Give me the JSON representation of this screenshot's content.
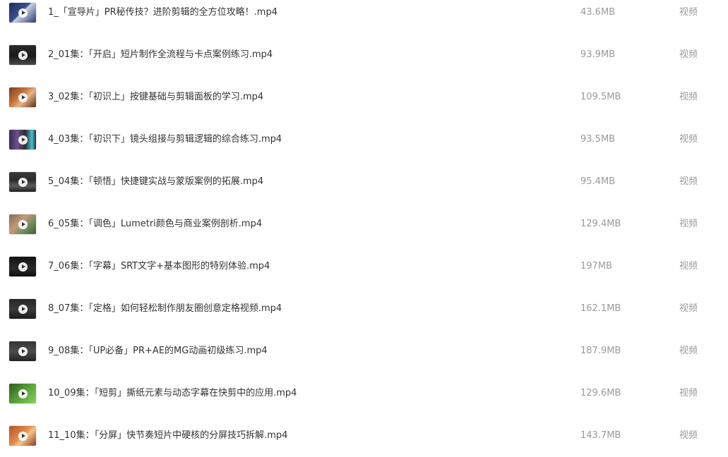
{
  "files": [
    {
      "name": "1_「宣导片」PR秘传技？进阶剪辑的全方位攻略！.mp4",
      "size": "43.6MB",
      "type": "视频",
      "thumb_style": "t-navy"
    },
    {
      "name": "2_01集：「开启」短片制作全流程与卡点案例练习.mp4",
      "size": "93.9MB",
      "type": "视频",
      "thumb_style": "t-dark"
    },
    {
      "name": "3_02集：「初识上」按键基础与剪辑面板的学习.mp4",
      "size": "109.5MB",
      "type": "视频",
      "thumb_style": "t-warm"
    },
    {
      "name": "4_03集：「初识下」镜头组接与剪辑逻辑的综合练习.mp4",
      "size": "93.5MB",
      "type": "视频",
      "thumb_style": "t-purple"
    },
    {
      "name": "5_04集：「顿悟」快捷键实战与蒙版案例的拓展.mp4",
      "size": "95.4MB",
      "type": "视频",
      "thumb_style": "t-ui"
    },
    {
      "name": "6_05集：「调色」Lumetri颜色与商业案例剖析.mp4",
      "size": "129.4MB",
      "type": "视频",
      "thumb_style": "t-photo"
    },
    {
      "name": "7_06集：「字幕」SRT文字+基本图形的特别体验.mp4",
      "size": "197MB",
      "type": "视频",
      "thumb_style": "t-black"
    },
    {
      "name": "8_07集：「定格」如何轻松制作朋友圈创意定格视频.mp4",
      "size": "162.1MB",
      "type": "视频",
      "thumb_style": "t-editor"
    },
    {
      "name": "9_08集：「UP必备」PR+AE的MG动画初级练习.mp4",
      "size": "187.9MB",
      "type": "视频",
      "thumb_style": "t-slate"
    },
    {
      "name": "10_09集：「短剪」撕纸元素与动态字幕在快剪中的应用.mp4",
      "size": "129.6MB",
      "type": "视频",
      "thumb_style": "t-green"
    },
    {
      "name": "11_10集：「分屏」快节奏短片中硬核的分屏技巧拆解.mp4",
      "size": "143.7MB",
      "type": "视频",
      "thumb_style": "t-sunset"
    }
  ]
}
